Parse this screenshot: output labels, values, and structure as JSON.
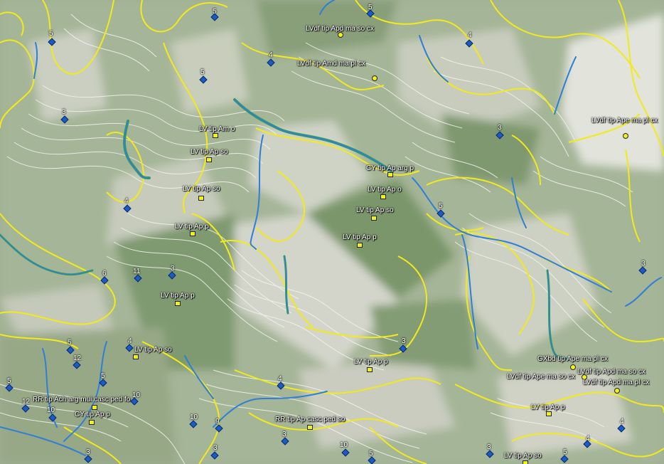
{
  "map": {
    "colors": {
      "field_light": "#c9cdbf",
      "field_green": "#7d9a6e",
      "contour_yellow": "#f2ea1a",
      "contour_white": "#f4f4ee",
      "stream_blue": "#2f7fd6",
      "stream_green": "#3ca043",
      "marker_yellow": "#f2f21a",
      "marker_blue": "#1c5ac4"
    },
    "soil_labels": [
      {
        "text": "LVdf tip Apd ma so cx",
        "marker": "circle"
      },
      {
        "text": "LVdf tip Amd ma pl cx",
        "marker": "circle"
      },
      {
        "text": "LVdf tip Ape ma pl cx",
        "marker": "circle"
      },
      {
        "text": "LV tip Am o",
        "marker": "square"
      },
      {
        "text": "LV tip Ap so",
        "marker": "square"
      },
      {
        "text": "LV tip Ap so",
        "marker": "square"
      },
      {
        "text": "LV tip Ap p",
        "marker": "square"
      },
      {
        "text": "LV tip Ap p",
        "marker": "square"
      },
      {
        "text": "CY tip Ap arg p",
        "marker": "square"
      },
      {
        "text": "LV tip Ap o",
        "marker": "square"
      },
      {
        "text": "LV tip Ap so",
        "marker": "square"
      },
      {
        "text": "LV tip Ap p",
        "marker": "square"
      },
      {
        "text": "LV tip Ap so",
        "marker": "square"
      },
      {
        "text": "LV tip Ap p",
        "marker": "square"
      },
      {
        "text": "GXbd tip Ape ma pl cx",
        "marker": "circle"
      },
      {
        "text": "LVdf tip Ape ma so cx",
        "marker": "circle"
      },
      {
        "text": "LVdf tip Apd ma so cx",
        "marker": "circle"
      },
      {
        "text": "LVdf tip Apd ma pl cx",
        "marker": "circle"
      },
      {
        "text": "RR tip Ach arg mui casc ped fo",
        "marker": "square"
      },
      {
        "text": "CY tip Ap p",
        "marker": "square"
      },
      {
        "text": "RR tip Ap casc ped so",
        "marker": "square"
      },
      {
        "text": "LV tip Ap p",
        "marker": "square"
      },
      {
        "text": "LV tip Ap so",
        "marker": "square"
      }
    ],
    "class_points": [
      {
        "text": "5"
      },
      {
        "text": "5"
      },
      {
        "text": "5"
      },
      {
        "text": "4"
      },
      {
        "text": "4"
      },
      {
        "text": "5"
      },
      {
        "text": "3"
      },
      {
        "text": "3"
      },
      {
        "text": "4"
      },
      {
        "text": "5"
      },
      {
        "text": "6"
      },
      {
        "text": "11"
      },
      {
        "text": "3"
      },
      {
        "text": "3"
      },
      {
        "text": "3"
      },
      {
        "text": "4"
      },
      {
        "text": "5"
      },
      {
        "text": "12"
      },
      {
        "text": "5"
      },
      {
        "text": "5"
      },
      {
        "text": "12"
      },
      {
        "text": "10"
      },
      {
        "text": "10"
      },
      {
        "text": "10"
      },
      {
        "text": "9"
      },
      {
        "text": "4"
      },
      {
        "text": "3"
      },
      {
        "text": "3"
      },
      {
        "text": "10"
      },
      {
        "text": "5"
      },
      {
        "text": "4"
      },
      {
        "text": "5"
      },
      {
        "text": "3"
      },
      {
        "text": "4"
      },
      {
        "text": "3"
      }
    ]
  }
}
